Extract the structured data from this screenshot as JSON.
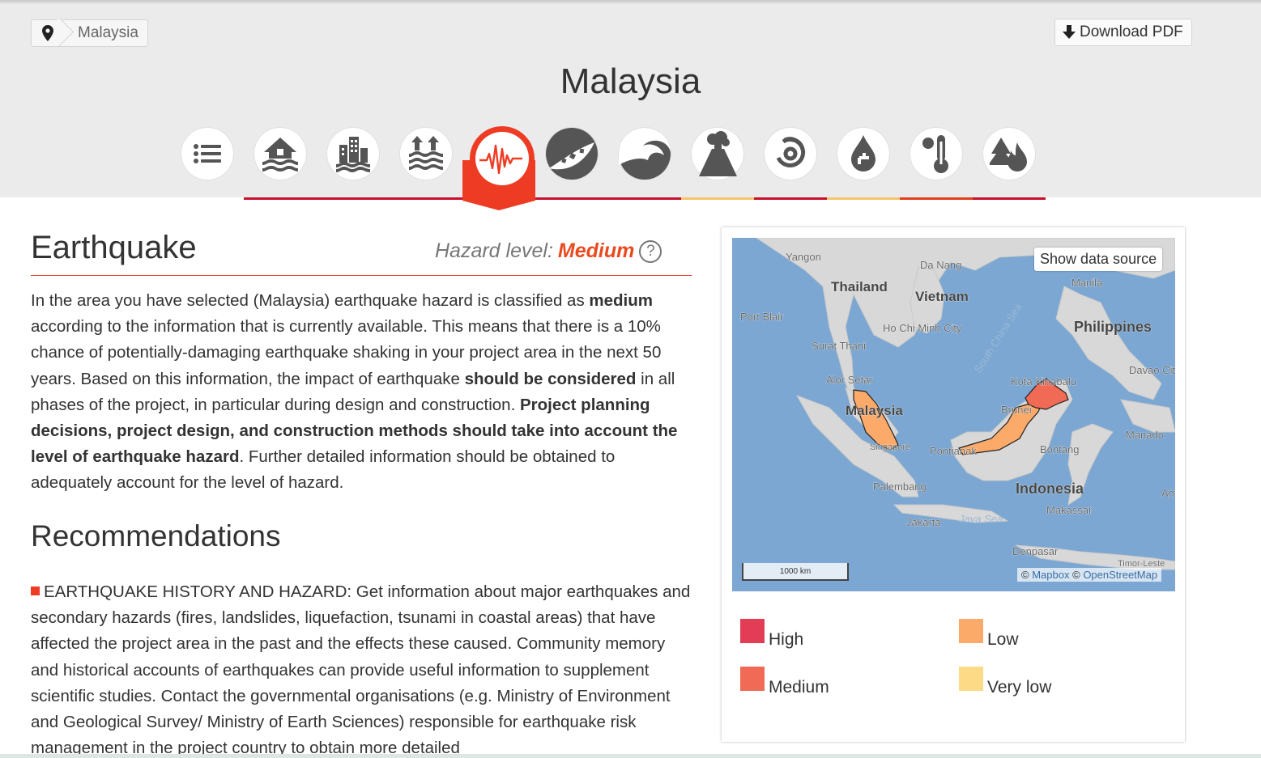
{
  "breadcrumb": {
    "pin_icon": "map-pin-icon",
    "label": "Malaysia"
  },
  "download_pdf": {
    "icon": "download-arrow-icon",
    "label": "Download PDF"
  },
  "page_title": "Malaysia",
  "hazard_tabs": [
    {
      "name": "list-icon",
      "label": ""
    },
    {
      "name": "river-flood-icon",
      "label": ""
    },
    {
      "name": "urban-flood-icon",
      "label": ""
    },
    {
      "name": "coastal-flood-icon",
      "label": ""
    },
    {
      "name": "earthquake-icon",
      "label": "",
      "active": true
    },
    {
      "name": "landslide-icon",
      "label": ""
    },
    {
      "name": "tsunami-icon",
      "label": ""
    },
    {
      "name": "volcano-icon",
      "label": ""
    },
    {
      "name": "cyclone-icon",
      "label": ""
    },
    {
      "name": "water-scarcity-icon",
      "label": ""
    },
    {
      "name": "extreme-heat-icon",
      "label": ""
    },
    {
      "name": "wildfire-icon",
      "label": ""
    }
  ],
  "hazard_bar_colors": [
    "#c8102e",
    "#c8102e",
    "#c8102e",
    "#c8102e",
    "#c8102e",
    "#c8102e",
    "#f7c46c",
    "#c8102e",
    "#f7c46c",
    "#e2401c",
    "#c8102e"
  ],
  "section": {
    "title": "Earthquake",
    "hazard_level_label": "Hazard level:",
    "hazard_level_value": "Medium",
    "help_symbol": "?"
  },
  "description": {
    "p1": "In the area you have selected (Malaysia) earthquake hazard is classified as ",
    "b1": "medium",
    "p2": " according to the information that is currently available. This means that there is a 10% chance of potentially-damaging earthquake shaking in your project area in the next 50 years. Based on this information, the impact of earthquake ",
    "b2": "should be considered",
    "p3": " in all phases of the project, in particular during design and construction. ",
    "b3": "Project planning decisions, project design, and construction methods should take into account the level of earthquake hazard",
    "p4": ". Further detailed information should be obtained to adequately account for the level of hazard."
  },
  "recommendations": {
    "title": "Recommendations",
    "item1": "EARTHQUAKE HISTORY AND HAZARD: Get information about major earthquakes and secondary hazards (fires, landslides, liquefaction, tsunami in coastal areas) that have affected the project area in the past and the effects these caused. Community memory and historical accounts of earthquakes can provide useful information to supplement scientific studies. Contact the governmental organisations (e.g. Ministry of Environment and Geological Survey/ Ministry of Earth Sciences) responsible for earthquake risk management in the project country to obtain more detailed"
  },
  "map": {
    "show_source_label": "Show data source",
    "scale_label": "1000 km",
    "attribution_copy1": "©",
    "attribution_mapbox": "Mapbox",
    "attribution_copy2": "©",
    "attribution_osm": "OpenStreetMap",
    "places": {
      "yangon": "Yangon",
      "da_nang": "Da Nang",
      "thailand": "Thailand",
      "vietnam": "Vietnam",
      "manila": "Manila",
      "port_blair": "Port Blair",
      "hcmc": "Ho Chi Minh City",
      "philippines": "Philippines",
      "surat_thani": "Surat Thani",
      "south_china_sea": "South China Sea",
      "davao": "Davao City",
      "alor_setar": "Alor Setar",
      "kota_kinabalu": "Kota Kinabalu",
      "malaysia": "Malaysia",
      "brunei": "Brunei",
      "manado": "Manado",
      "singapore": "Singapore",
      "pontianak": "Pontianak",
      "bontang": "Bontang",
      "palembang": "Palembang",
      "indonesia": "Indonesia",
      "ambon": "Amb",
      "makassar": "Makassar",
      "jakarta": "Jakarta",
      "java_sea": "Java Sea",
      "denpasar": "Denpasar",
      "timor_leste": "Timor-Leste"
    }
  },
  "legend": [
    {
      "label": "High",
      "color": "#e23c57"
    },
    {
      "label": "Low",
      "color": "#fcaa6a"
    },
    {
      "label": "Medium",
      "color": "#f06a55"
    },
    {
      "label": "Very low",
      "color": "#fddb86"
    }
  ]
}
